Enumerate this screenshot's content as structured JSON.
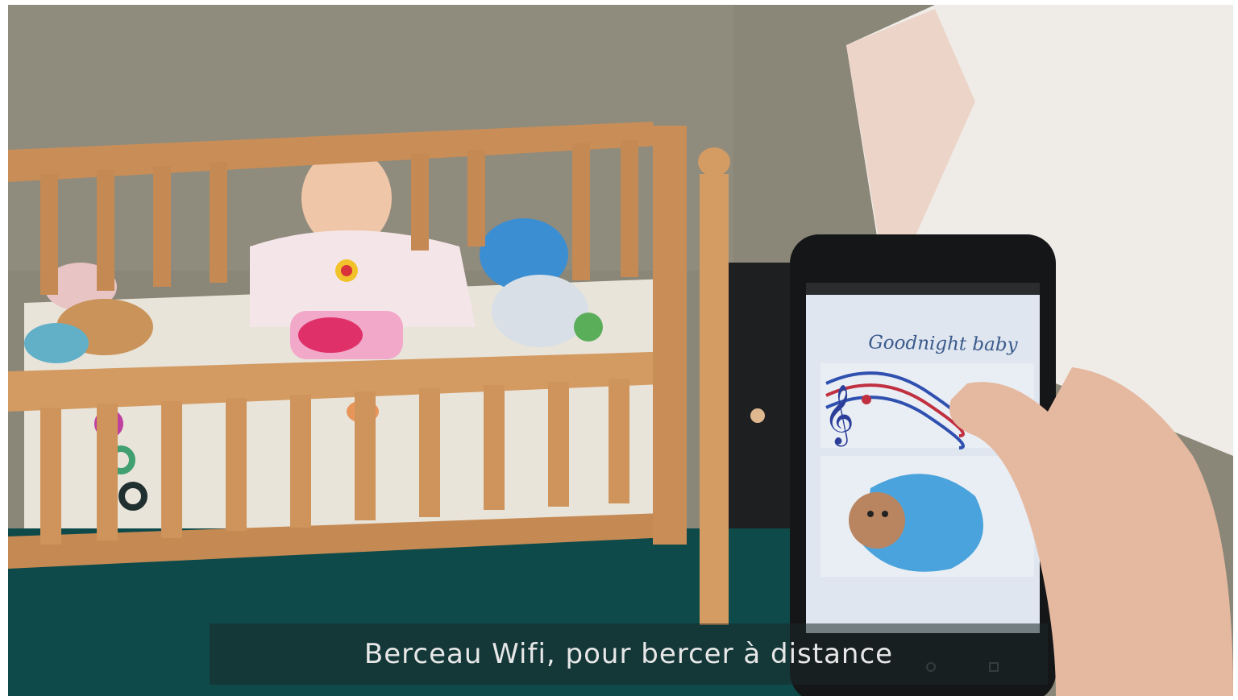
{
  "video": {
    "subtitle": "Berceau Wifi, pour bercer à distance"
  },
  "phone_app": {
    "title": "Goodnight baby",
    "music_button_icon": "music-notes-icon",
    "rock_button_icon": "swaddled-baby-icon"
  },
  "colors": {
    "wall": "#8a8678",
    "crib_wood": "#c98e57",
    "blanket_teal": "#0f4a4a",
    "phone_screen": "#dfe6ef",
    "baby_blanket_blue": "#4aa3dc"
  }
}
